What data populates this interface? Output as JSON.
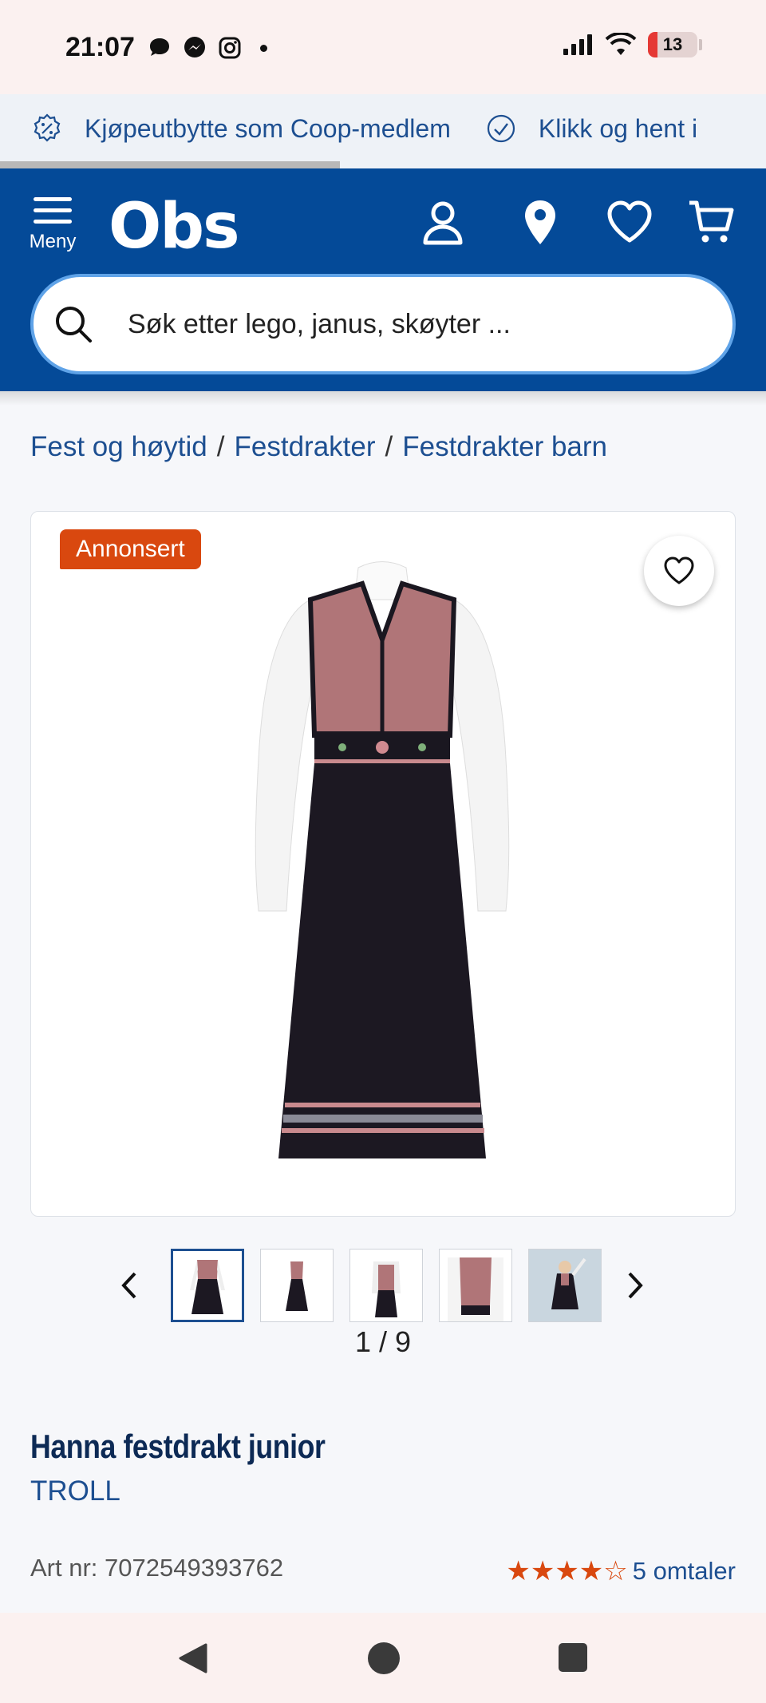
{
  "status_bar": {
    "time": "21:07",
    "battery": "13",
    "icons": [
      "chat-bubble-icon",
      "messenger-icon",
      "instagram-icon",
      "notification-dot",
      "signal-icon",
      "wifi-icon",
      "battery-icon"
    ]
  },
  "promo": {
    "items": [
      "Kjøpeutbytte som Coop-medlem",
      "Klikk og hent i"
    ]
  },
  "header": {
    "menu_label": "Meny",
    "logo": "Obs",
    "search_placeholder": "Søk etter lego, janus, skøyter ..."
  },
  "breadcrumb": [
    "Fest og høytid",
    "Festdrakter",
    "Festdrakter barn"
  ],
  "product": {
    "badge": "Annonsert",
    "image_counter": "1 / 9",
    "title": "Hanna festdrakt junior",
    "brand": "TROLL",
    "art_nr": "Art nr: 7072549393762",
    "rating_stars": "★★★★☆",
    "rating_value": 4,
    "reviews": "5 omtaler"
  },
  "colors": {
    "header_blue": "#044a98",
    "link_blue": "#1d4f91",
    "badge_orange": "#d9480f",
    "status_bg": "#fbf1f0"
  }
}
